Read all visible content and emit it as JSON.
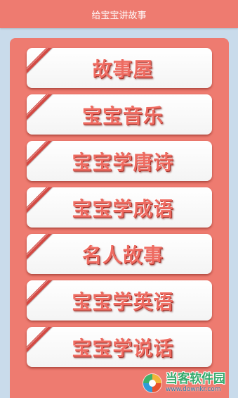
{
  "header": {
    "title": "给宝宝讲故事"
  },
  "menu": {
    "items": [
      {
        "label": "故事屋"
      },
      {
        "label": "宝宝音乐"
      },
      {
        "label": "宝宝学唐诗"
      },
      {
        "label": "宝宝学成语"
      },
      {
        "label": "名人故事"
      },
      {
        "label": "宝宝学英语"
      },
      {
        "label": "宝宝学说话"
      }
    ]
  },
  "watermark": {
    "name": "当客软件园",
    "url": "www.downkr.com"
  },
  "colors": {
    "header_bg": "#ee7b70",
    "panel_bg": "#ee7b70",
    "page_bg": "#c9dbeb",
    "button_bg": "#ffffff",
    "label_color": "#ee6b61",
    "ribbon": "#d34a44"
  }
}
